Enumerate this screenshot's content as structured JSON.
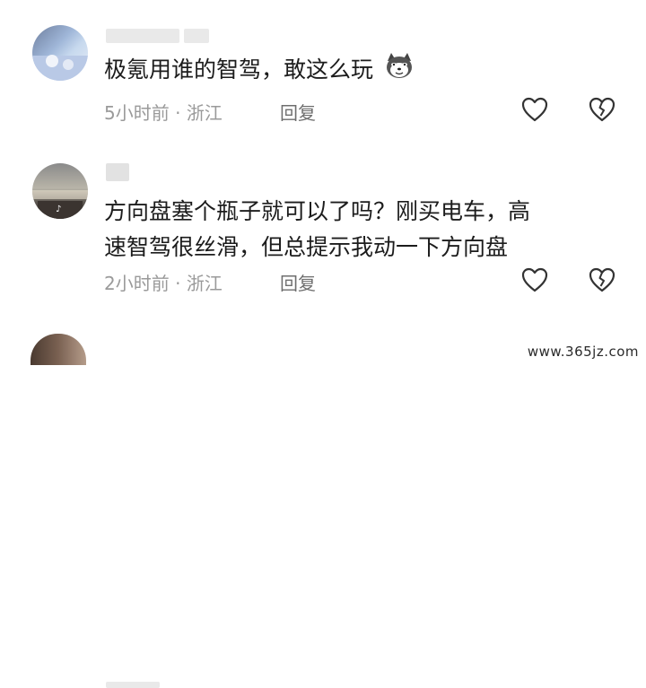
{
  "comments": [
    {
      "text_lines": [
        "极氪用谁的智驾，敢这么玩"
      ],
      "time": "5小时前",
      "dot": "·",
      "location": "浙江",
      "reply_label": "回复",
      "like_icon": "heart-outline-icon",
      "dislike_icon": "broken-heart-icon",
      "emoji": "husky-dog-emoji"
    },
    {
      "text_lines": [
        "方向盘塞个瓶子就可以了吗？刚买电车，高",
        "速智驾很丝滑，但总提示我动一下方向盘"
      ],
      "time": "2小时前",
      "dot": "·",
      "location": "浙江",
      "reply_label": "回复",
      "like_icon": "heart-outline-icon",
      "dislike_icon": "broken-heart-icon"
    }
  ],
  "watermark": "www.365jz.com"
}
